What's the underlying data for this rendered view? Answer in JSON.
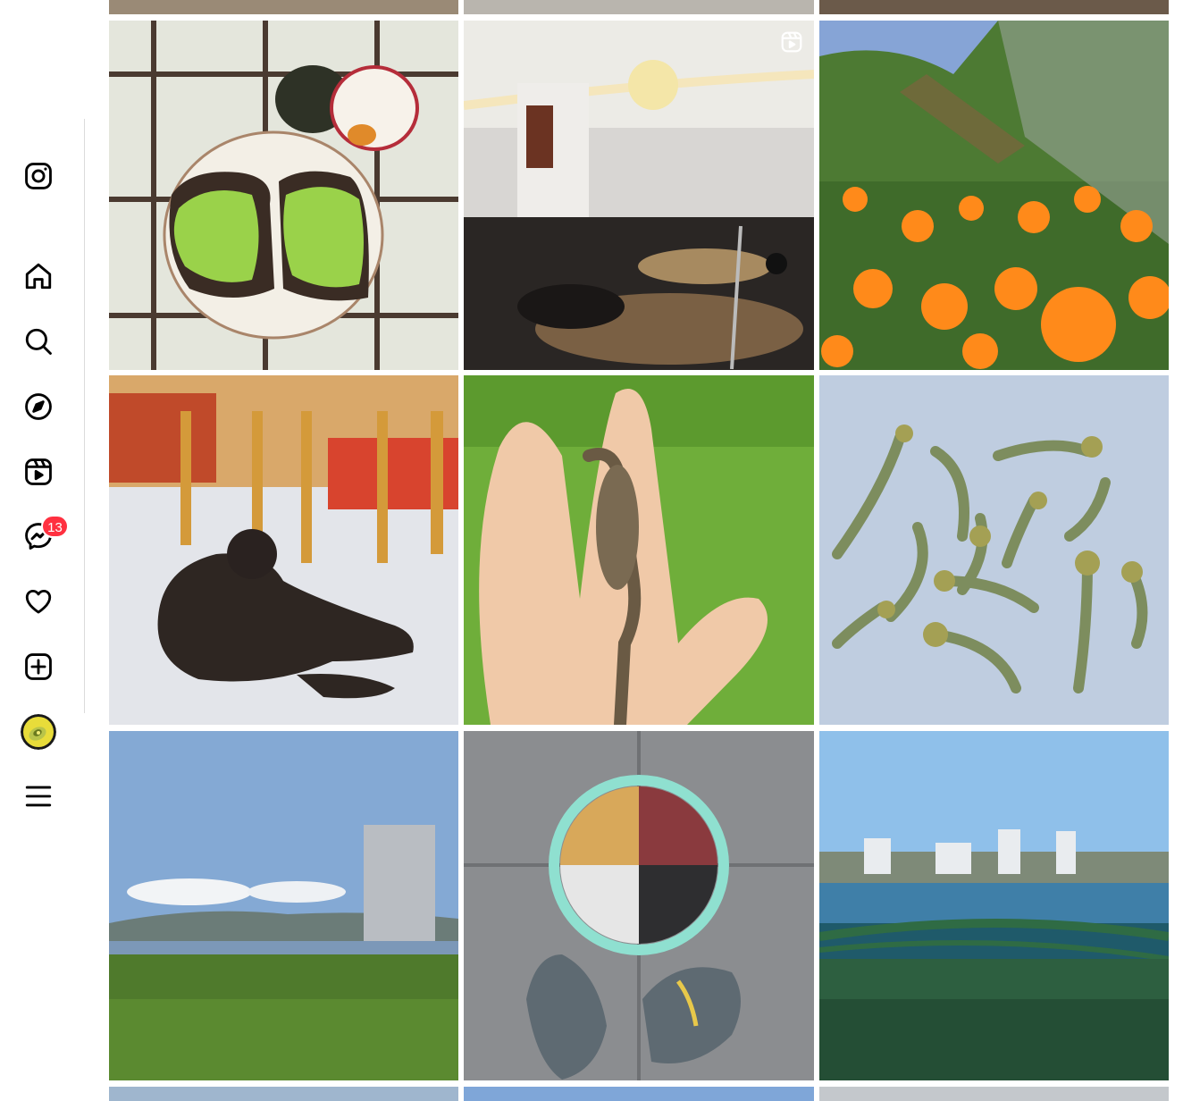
{
  "sidebar": {
    "items": [
      {
        "name": "instagram-logo-icon"
      },
      {
        "name": "home-icon"
      },
      {
        "name": "search-icon"
      },
      {
        "name": "explore-icon"
      },
      {
        "name": "reels-icon"
      },
      {
        "name": "messenger-icon"
      },
      {
        "name": "heart-icon"
      },
      {
        "name": "create-icon"
      },
      {
        "name": "profile-avatar"
      },
      {
        "name": "menu-icon"
      }
    ],
    "messages_badge": "13"
  },
  "posts": [
    {
      "subject": "avocado-toast",
      "type": "photo"
    },
    {
      "subject": "drum-kit",
      "type": "reel"
    },
    {
      "subject": "poppies",
      "type": "photo"
    },
    {
      "subject": "cat",
      "type": "photo"
    },
    {
      "subject": "lizard-on-hand",
      "type": "photo"
    },
    {
      "subject": "dried-mushrooms",
      "type": "photo"
    },
    {
      "subject": "lake-lawn",
      "type": "photo"
    },
    {
      "subject": "medicine-wheel-chalk",
      "type": "photo"
    },
    {
      "subject": "lake-bridge",
      "type": "photo"
    }
  ],
  "colors": {
    "badge": "#ff3040",
    "divider": "#dbdbdb",
    "icon": "#000000"
  }
}
